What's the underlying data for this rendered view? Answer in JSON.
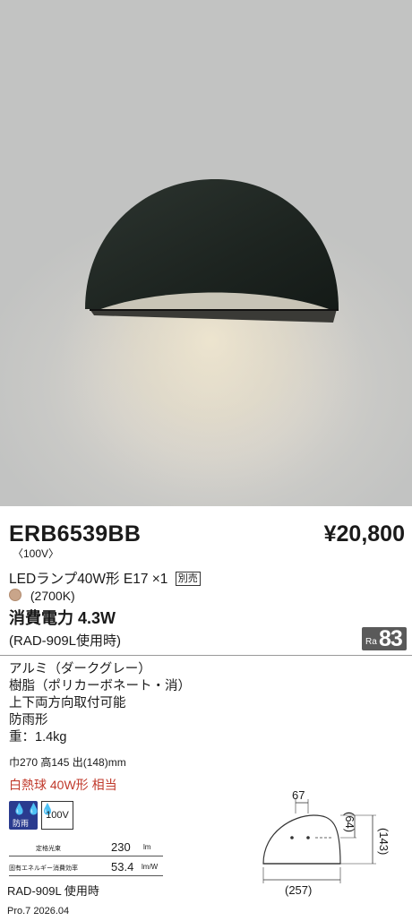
{
  "product": {
    "model": "ERB6539BB",
    "price": "¥20,800",
    "voltage_tag": "〈100V〉",
    "lamp": "LEDランプ40W形 E17 ×1",
    "sold_separately": "別売",
    "color_temp": "(2700K)",
    "power": "消費電力 4.3W",
    "power_note": "(RAD-909L使用時)",
    "ra_label": "Ra",
    "ra_value": "83"
  },
  "specs": [
    "アルミ（ダークグレー）",
    "樹脂（ポリカーボネート・消）",
    "上下両方向取付可能",
    "防雨形",
    "重：1.4kg"
  ],
  "dimensions_text": "巾270 高145 出(148)mm",
  "equivalent": "白熱球 40W形 相当",
  "icons": {
    "rain_drops": "💧💧💧",
    "rain_label": "防雨",
    "voltage_box": "100V",
    "lamp_color_dot": "#c9a58a"
  },
  "efficiency": {
    "flux_label": "定格光束",
    "flux_value": "230",
    "flux_unit": "lm",
    "eff_label": "固有エネルギー消費効率",
    "eff_value": "53.4",
    "eff_unit": "lm/W"
  },
  "tube_note": "RAD-909L 使用時",
  "footer": "Pro.7 2026.04",
  "diagram": {
    "dim_top": "67",
    "dim_h1": "(64)",
    "dim_h2": "(143)",
    "dim_w": "(257)"
  }
}
